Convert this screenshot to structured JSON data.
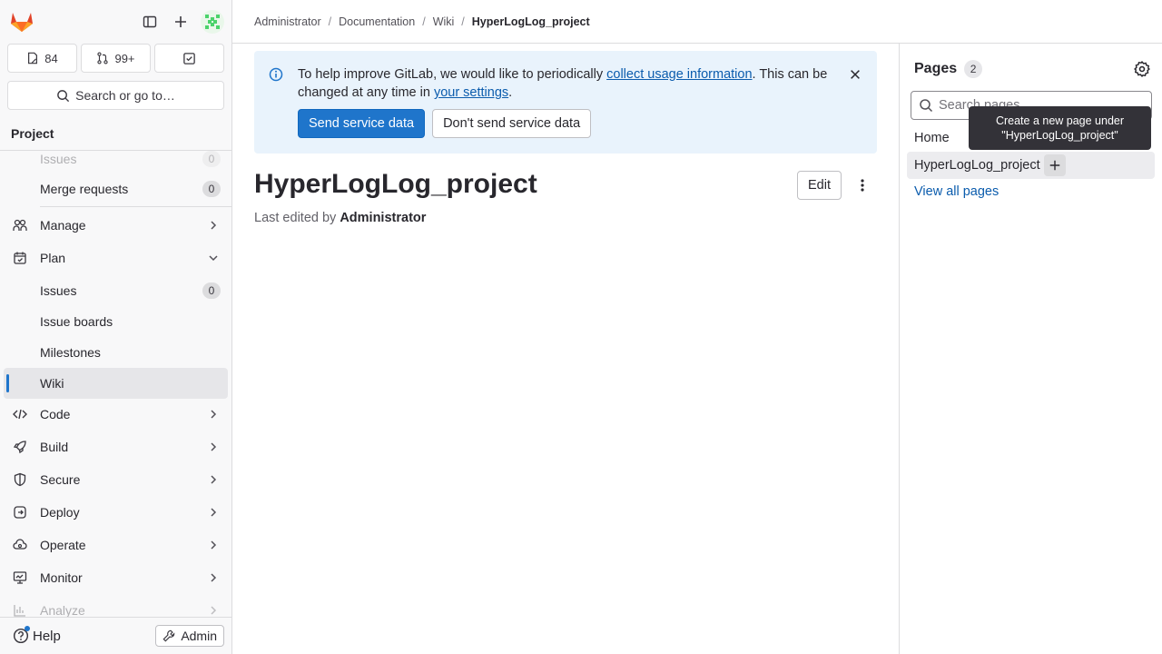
{
  "sidebar": {
    "counters": {
      "issues": "84",
      "merge_requests": "99+"
    },
    "search_label": "Search or go to…",
    "section_title": "Project",
    "items": {
      "issues_top": {
        "label": "Issues",
        "badge": "0"
      },
      "merge_requests": {
        "label": "Merge requests",
        "badge": "0"
      },
      "manage": {
        "label": "Manage"
      },
      "plan": {
        "label": "Plan"
      },
      "plan_issues": {
        "label": "Issues",
        "badge": "0"
      },
      "issue_boards": {
        "label": "Issue boards"
      },
      "milestones": {
        "label": "Milestones"
      },
      "wiki": {
        "label": "Wiki"
      },
      "code": {
        "label": "Code"
      },
      "build": {
        "label": "Build"
      },
      "secure": {
        "label": "Secure"
      },
      "deploy": {
        "label": "Deploy"
      },
      "operate": {
        "label": "Operate"
      },
      "monitor": {
        "label": "Monitor"
      },
      "analyze": {
        "label": "Analyze"
      }
    },
    "help_label": "Help",
    "admin_label": "Admin"
  },
  "breadcrumb": [
    "Administrator",
    "Documentation",
    "Wiki",
    "HyperLogLog_project"
  ],
  "alert": {
    "text_before": "To help improve GitLab, we would like to periodically ",
    "link1": "collect usage information",
    "text_middle": ". This can be changed at any time in ",
    "link2": "your settings",
    "text_after": ".",
    "primary_button": "Send service data",
    "secondary_button": "Don't send service data"
  },
  "page": {
    "title": "HyperLogLog_project",
    "edit_label": "Edit",
    "last_edited_prefix": "Last edited by ",
    "last_edited_by": "Administrator"
  },
  "pages_panel": {
    "title": "Pages",
    "count": "2",
    "search_placeholder": "Search pages",
    "items": [
      "Home",
      "HyperLogLog_project"
    ],
    "view_all": "View all pages",
    "tooltip": "Create a new page under \"HyperLogLog_project\""
  },
  "colors": {
    "accent": "#1f75cb",
    "alert_bg": "#e9f3fc",
    "link": "#0b5cad"
  }
}
